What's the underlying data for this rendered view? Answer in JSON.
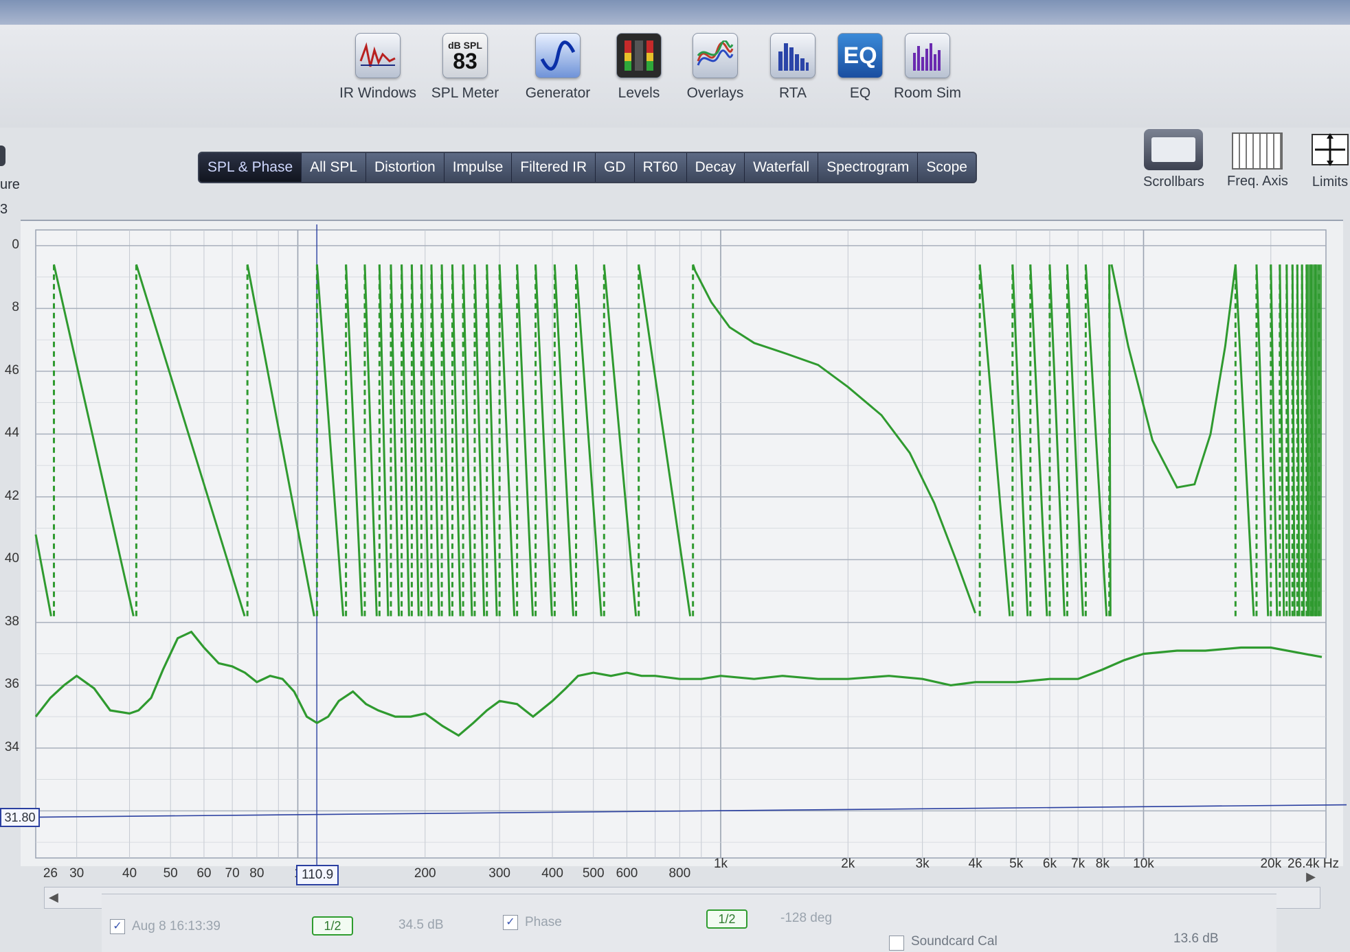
{
  "toolbar": {
    "items": [
      {
        "label": "IR Windows",
        "icon": "ir-windows-icon"
      },
      {
        "label": "SPL Meter",
        "icon": "spl-meter-icon",
        "badge_top": "dB SPL",
        "badge_value": "83"
      },
      {
        "label": "Generator",
        "icon": "generator-icon"
      },
      {
        "label": "Levels",
        "icon": "levels-icon"
      },
      {
        "label": "Overlays",
        "icon": "overlays-icon"
      },
      {
        "label": "RTA",
        "icon": "rta-icon"
      },
      {
        "label": "EQ",
        "icon": "eq-icon",
        "badge_value": "EQ"
      },
      {
        "label": "Room Sim",
        "icon": "room-sim-icon"
      }
    ]
  },
  "left_labels": {
    "partial_1": "ure",
    "partial_2": "3"
  },
  "tabs": [
    "SPL & Phase",
    "All SPL",
    "Distortion",
    "Impulse",
    "Filtered IR",
    "GD",
    "RT60",
    "Decay",
    "Waterfall",
    "Spectrogram",
    "Scope"
  ],
  "active_tab": "SPL & Phase",
  "right_tools": [
    {
      "label": "Scrollbars",
      "icon": "scrollbars-icon"
    },
    {
      "label": "Freq. Axis",
      "icon": "freq-axis-icon"
    },
    {
      "label": "Limits",
      "icon": "limits-icon"
    }
  ],
  "chart_data": {
    "type": "line",
    "x_scale": "log",
    "xlim": [
      24,
      27000
    ],
    "ylim": [
      30.5,
      50.5
    ],
    "y_ticks": [
      "0",
      "8",
      "46",
      "44",
      "42",
      "40",
      "38",
      "36",
      "34"
    ],
    "x_ticks": [
      "26",
      "30",
      "40",
      "50",
      "60",
      "70",
      "80",
      "1",
      "200",
      "300",
      "400",
      "500",
      "600",
      "800",
      "1k",
      "2k",
      "3k",
      "4k",
      "5k",
      "6k",
      "7k",
      "8k",
      "10k",
      "20k",
      "26.4k Hz"
    ],
    "cursor": {
      "x": 110.9,
      "label": "110.9"
    },
    "level_marker": {
      "y": 31.8,
      "label": "31.80"
    },
    "series": [
      {
        "style": "solid",
        "color": "#2f9a2f",
        "x": [
          24,
          26,
          28,
          30,
          33,
          36,
          40,
          42,
          45,
          48,
          52,
          56,
          60,
          65,
          70,
          75,
          80,
          86,
          92,
          98,
          105,
          111,
          118,
          125,
          135,
          145,
          155,
          170,
          185,
          200,
          220,
          240,
          260,
          280,
          300,
          330,
          360,
          400,
          430,
          460,
          500,
          550,
          600,
          650,
          700,
          800,
          900,
          1000,
          1200,
          1400,
          1700,
          2000,
          2500,
          3000,
          3500,
          4000,
          4500,
          5000,
          6000,
          7000,
          8000,
          9000,
          10000,
          12000,
          14000,
          17000,
          20000,
          24000,
          26400
        ],
        "y": [
          35.0,
          35.6,
          36.0,
          36.3,
          35.9,
          35.2,
          35.1,
          35.2,
          35.6,
          36.5,
          37.5,
          37.7,
          37.2,
          36.7,
          36.6,
          36.4,
          36.1,
          36.3,
          36.2,
          35.8,
          35.0,
          34.8,
          35.0,
          35.5,
          35.8,
          35.4,
          35.2,
          35.0,
          35.0,
          35.1,
          34.7,
          34.4,
          34.8,
          35.2,
          35.5,
          35.4,
          35.0,
          35.5,
          35.9,
          36.3,
          36.4,
          36.3,
          36.4,
          36.3,
          36.3,
          36.2,
          36.2,
          36.3,
          36.2,
          36.3,
          36.2,
          36.2,
          36.3,
          36.2,
          36.0,
          36.1,
          36.1,
          36.1,
          36.2,
          36.2,
          36.5,
          36.8,
          37.0,
          37.1,
          37.1,
          37.2,
          37.2,
          37.0,
          36.9
        ]
      },
      {
        "style": "sawtooth",
        "color": "#2f9a2f",
        "wrap_top": 49.4,
        "wrap_bottom": 38.2,
        "wrap_frequencies": [
          26.5,
          41.5,
          76,
          111,
          130,
          144,
          156,
          166,
          176,
          186,
          196,
          207,
          219,
          232,
          246,
          262,
          280,
          300,
          330,
          365,
          405,
          455,
          530,
          640,
          860,
          4100,
          4900,
          5400,
          6000,
          6600,
          7300,
          8300,
          16500,
          18500,
          20000,
          21000,
          21800,
          22500,
          23100,
          23700,
          24300,
          24900,
          25500,
          26000
        ],
        "x": [
          870,
          950,
          1050,
          1200,
          1400,
          1700,
          2000,
          2400,
          2800,
          3200,
          3600,
          4000
        ],
        "y": [
          49.2,
          48.2,
          47.4,
          46.9,
          46.6,
          46.2,
          45.5,
          44.6,
          43.4,
          41.8,
          40.0,
          38.3
        ],
        "valley": {
          "x": [
            8400,
            9200,
            10500,
            12000,
            13200,
            14400,
            15600,
            16500
          ],
          "y": [
            49.4,
            46.8,
            43.8,
            42.3,
            42.4,
            44.0,
            46.8,
            49.4
          ]
        }
      }
    ]
  },
  "legend": {
    "entry1": {
      "checked": true,
      "label": "Aug 8 16:13:39",
      "smoothing": "1/2",
      "value": "34.5 dB"
    },
    "entry2": {
      "checked": true,
      "label": "Phase",
      "smoothing": "1/2",
      "value": "-128 deg"
    },
    "soundcard": {
      "checked": false,
      "label": "Soundcard Cal",
      "value": "13.6 dB"
    }
  }
}
